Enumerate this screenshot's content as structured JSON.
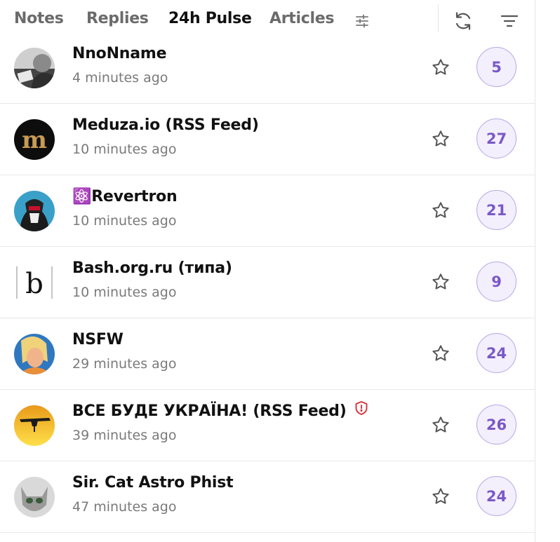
{
  "tabs": [
    {
      "label": "Notes"
    },
    {
      "label": "Replies"
    },
    {
      "label": "24h Pulse"
    },
    {
      "label": "Articles"
    }
  ],
  "active_tab": "24h Pulse",
  "accent_color": "#7a59c6",
  "icons": {
    "tab_settings": "sliders-icon",
    "refresh": "refresh-icon",
    "filter": "filter-icon",
    "star": "star-outline-icon",
    "verified": "shield-alert-icon"
  },
  "feed": [
    {
      "name": "NnoNname",
      "time": "4 minutes ago",
      "count": "5"
    },
    {
      "name": "Meduza.io (RSS Feed)",
      "time": "10 minutes ago",
      "count": "27"
    },
    {
      "name": "⚛️Revertron",
      "time": "10 minutes ago",
      "count": "21"
    },
    {
      "name": "Bash.org.ru (типа)",
      "time": "10 minutes ago",
      "count": "9"
    },
    {
      "name": "NSFW",
      "time": "29 minutes ago",
      "count": "24"
    },
    {
      "name": "ВСЕ БУДЕ УКРАЇНА! (RSS Feed)",
      "time": "39 minutes ago",
      "count": "26"
    },
    {
      "name": "Sir. Cat Astro Phist",
      "time": "47 minutes ago",
      "count": "24"
    }
  ]
}
